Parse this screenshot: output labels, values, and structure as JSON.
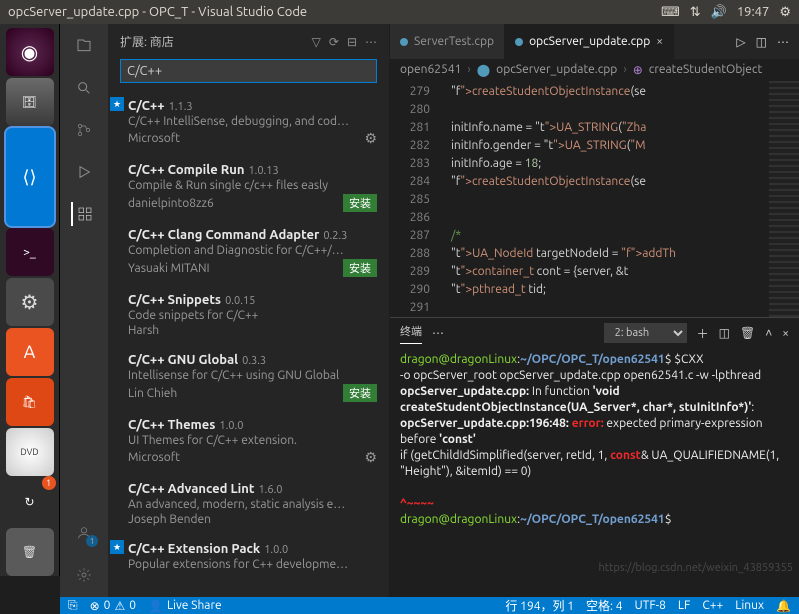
{
  "topbar": {
    "title": "opcServer_update.cpp - OPC_T - Visual Studio Code",
    "time": "19:47"
  },
  "launcher": {
    "badge": "1"
  },
  "sidebar": {
    "title": "扩展: 商店",
    "search": "C/C++",
    "exts": [
      {
        "star": true,
        "name": "C/C++",
        "ver": "1.1.3",
        "desc": "C/C++ IntelliSense, debugging, and cod…",
        "pub": "Microsoft",
        "gear": true
      },
      {
        "name": "C/C++ Compile Run",
        "ver": "1.0.13",
        "desc": "Compile & Run single c/c++ files easly",
        "pub": "danielpinto8zz6",
        "install": "安装"
      },
      {
        "name": "C/C++ Clang Command Adapter",
        "ver": "0.2.3",
        "desc": "Completion and Diagnostic for C/C++/…",
        "pub": "Yasuaki MITANI",
        "install": "安装"
      },
      {
        "name": "C/C++ Snippets",
        "ver": "0.0.15",
        "desc": "Code snippets for C/C++",
        "pub": "Harsh"
      },
      {
        "name": "C/C++ GNU Global",
        "ver": "0.3.3",
        "desc": "Intellisense for C/C++ using GNU Global",
        "pub": "Lin Chieh",
        "install": "安装"
      },
      {
        "name": "C/C++ Themes",
        "ver": "1.0.0",
        "desc": "UI Themes for C/C++ extension.",
        "pub": "Microsoft",
        "gear": true
      },
      {
        "name": "C/C++ Advanced Lint",
        "ver": "1.6.0",
        "desc": "An advanced, modern, static analysis e…",
        "pub": "Joseph Benden"
      },
      {
        "star": true,
        "name": "C/C++ Extension Pack",
        "ver": "1.0.0",
        "desc": "Popular extensions for C++ developme…",
        "pub": ""
      }
    ]
  },
  "tabs": {
    "inactive": "ServerTest.cpp",
    "active": "opcServer_update.cpp"
  },
  "crumbs": {
    "a": "open62541",
    "b": "opcServer_update.cpp",
    "c": "createStudentObject"
  },
  "code": {
    "start": 279,
    "lines": [
      "    createStudentObjectInstance(se",
      "",
      "    initInfo.name = UA_STRING(\"Zha",
      "    initInfo.gender = UA_STRING(\"M",
      "    initInfo.age = 18;",
      "    createStudentObjectInstance(se",
      "",
      "",
      "    /*",
      "    UA_NodeId targetNodeId = addTh",
      "    container_t cont = {server, &t",
      "    pthread_t tid;",
      ""
    ]
  },
  "terminal": {
    "tab": "终端",
    "shell": "2: bash",
    "t": {
      "p1": "dragon@dragonLinux",
      "p2": ":",
      "p3": "~/OPC/OPC_T/open62541",
      "p4": "$ $CXX",
      "l2": " -o opcServer_root opcServer_update.cpp open62541.c -w -lpthread",
      "l3a": "opcServer_update.cpp:",
      "l3b": " In function ",
      "l3c": "'void createStudentObjectInstance(UA_Server*, char*, stuInitInfo*)'",
      "l3d": ":",
      "l4a": "opcServer_update.cpp:196:48: ",
      "l4b": "error:",
      "l4c": " expected primary-expression before ",
      "l4d": "'const'",
      "l5": "     if (getChildIdSimplified(server, retId, 1, ",
      "l5b": "const",
      "l5c": "& UA_QUALIFIEDNAME(1, \"Height\"), &itemId) == 0)",
      "l7": "^~~~~",
      "p5": "dragon@dragonLinux",
      "p6": ":",
      "p7": "~/OPC/OPC_T/open62541",
      "p8": "$"
    }
  },
  "status": {
    "errors": "0",
    "warnings": "0",
    "live": "Live Share",
    "pos": "行 194，列 1",
    "spaces": "空格: 4",
    "enc": "UTF-8",
    "eol": "LF",
    "lang": "C++",
    "os": "Linux",
    "bell": "🔔"
  },
  "watermark": "https://blog.csdn.net/weixin_43859355"
}
